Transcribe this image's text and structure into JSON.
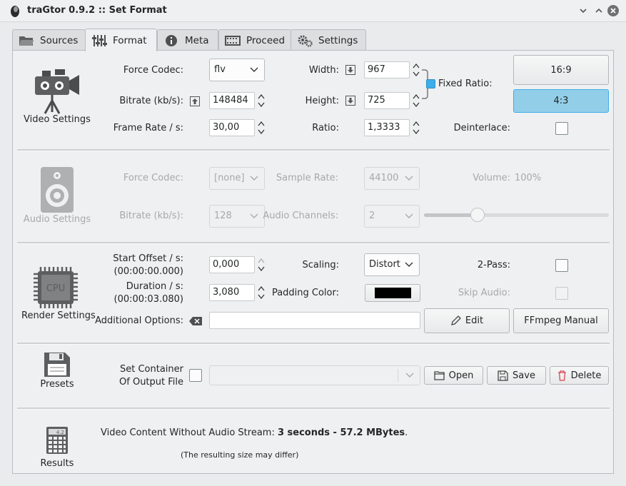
{
  "window": {
    "title": "traGtor 0.9.2 :: Set Format"
  },
  "tabs": [
    {
      "label": "Sources"
    },
    {
      "label": "Format"
    },
    {
      "label": "Meta"
    },
    {
      "label": "Proceed"
    },
    {
      "label": "Settings"
    }
  ],
  "video": {
    "section_label": "Video Settings",
    "force_codec_label": "Force Codec:",
    "force_codec_value": "flv",
    "bitrate_label": "Bitrate (kb/s):",
    "bitrate_value": "148484",
    "framerate_label": "Frame Rate / s:",
    "framerate_value": "30,00",
    "width_label": "Width:",
    "width_value": "967",
    "height_label": "Height:",
    "height_value": "725",
    "ratio_label": "Ratio:",
    "ratio_value": "1,3333",
    "fixed_ratio_label": "Fixed Ratio:",
    "fixed_ratio_checked": true,
    "preset_169": "16:9",
    "preset_43": "4:3",
    "deinterlace_label": "Deinterlace:",
    "deinterlace_checked": false
  },
  "audio": {
    "section_label": "Audio Settings",
    "force_codec_label": "Force Codec:",
    "force_codec_value": "[none]",
    "samplerate_label": "Sample Rate:",
    "samplerate_value": "44100",
    "volume_label": "Volume:",
    "volume_value": "100%",
    "volume_level": 0.27,
    "bitrate_label": "Bitrate (kb/s):",
    "bitrate_value": "128",
    "channels_label": "Audio Channels:",
    "channels_value": "2"
  },
  "render": {
    "section_label": "Render Settings",
    "start_offset_label": "Start Offset / s:",
    "start_offset_time": "(00:00:00.000)",
    "start_offset_value": "0,000",
    "duration_label": "Duration / s:",
    "duration_time": "(00:00:03.080)",
    "duration_value": "3,080",
    "scaling_label": "Scaling:",
    "scaling_value": "Distort",
    "padding_color_label": "Padding Color:",
    "padding_color_value": "#000000",
    "twopass_label": "2-Pass:",
    "skip_audio_label": "Skip Audio:",
    "additional_options_label": "Additional Options:",
    "additional_options_value": "",
    "edit_label": "Edit",
    "ffmpeg_manual_label": "FFmpeg Manual"
  },
  "presets": {
    "section_label": "Presets",
    "container_label_line1": "Set Container",
    "container_label_line2": "Of Output File",
    "open_label": "Open",
    "save_label": "Save",
    "delete_label": "Delete"
  },
  "results": {
    "section_label": "Results",
    "summary_prefix": "Video Content Without Audio Stream: ",
    "summary_bold": "3 seconds - 57.2 MBytes",
    "summary_suffix": ".",
    "note": "(The resulting size may differ)"
  },
  "colors": {
    "accent": "#3daee9",
    "selected_button": "#93cee9",
    "delete_icon": "#da4453"
  }
}
